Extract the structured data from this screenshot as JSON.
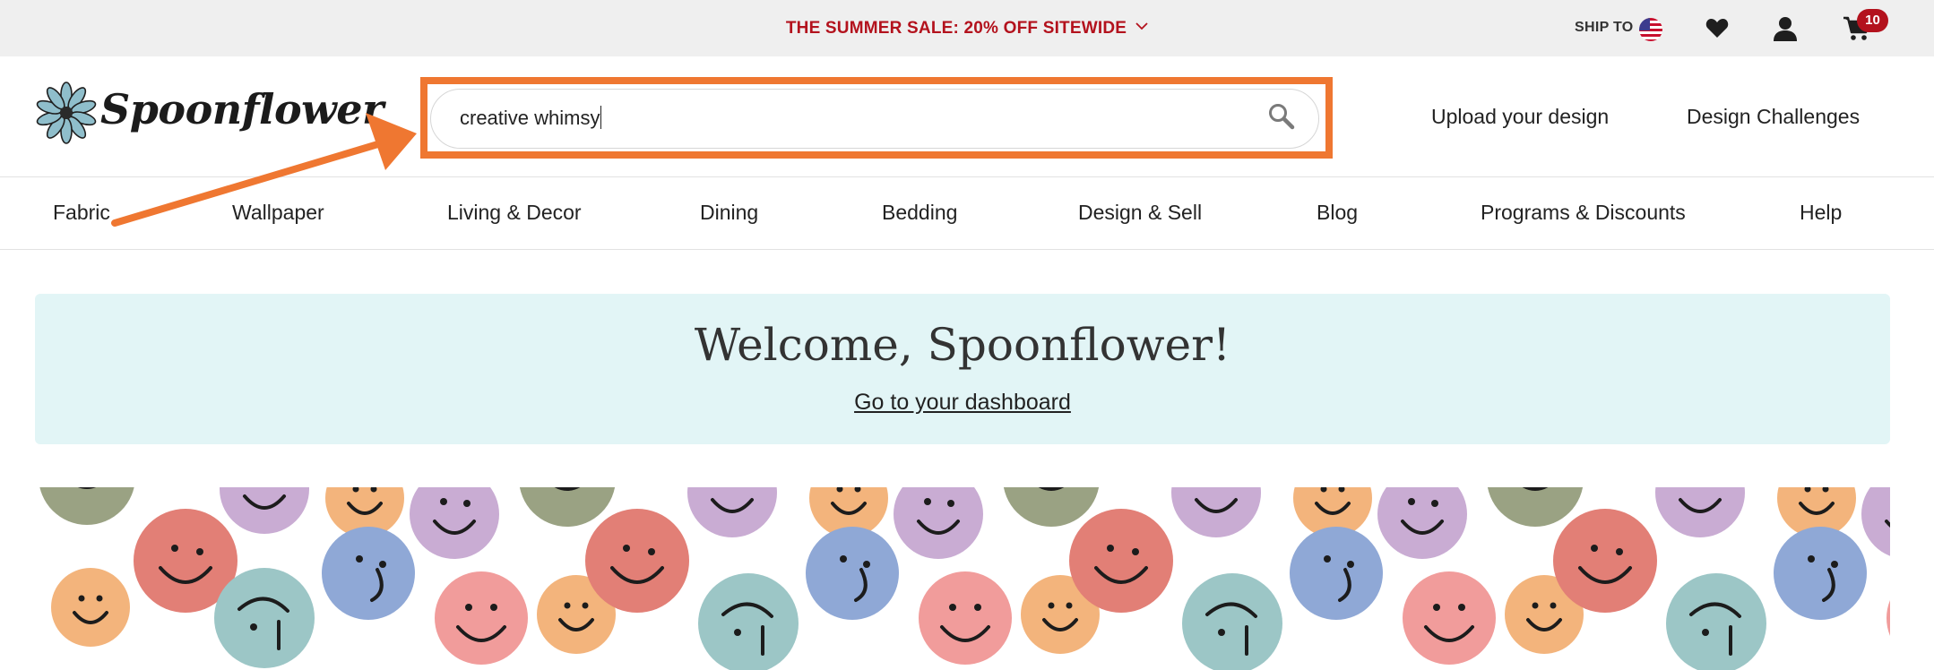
{
  "promo": {
    "text": "THE SUMMER SALE: 20% OFF SITEWIDE"
  },
  "utility": {
    "ship_to": "SHIP TO",
    "cart_count": "10"
  },
  "header": {
    "logo_text": "Spoonflower",
    "search": {
      "value": "creative whimsy"
    },
    "links": [
      "Upload your design",
      "Design Challenges"
    ]
  },
  "nav": {
    "items": [
      "Fabric",
      "Wallpaper",
      "Living & Decor",
      "Dining",
      "Bedding",
      "Design & Sell",
      "Blog",
      "Programs & Discounts",
      "Help"
    ]
  },
  "welcome": {
    "title": "Welcome, Spoonflower!",
    "link": "Go to your dashboard"
  },
  "colors": {
    "promo_text": "#b3121d",
    "highlight": "#ef7731",
    "welcome_bg": "#e2f5f6",
    "badge": "#b3121d"
  },
  "icons": [
    "chevron-down-icon",
    "us-flag-icon",
    "heart-icon",
    "user-icon",
    "cart-icon",
    "search-icon",
    "flower-logo-icon"
  ]
}
